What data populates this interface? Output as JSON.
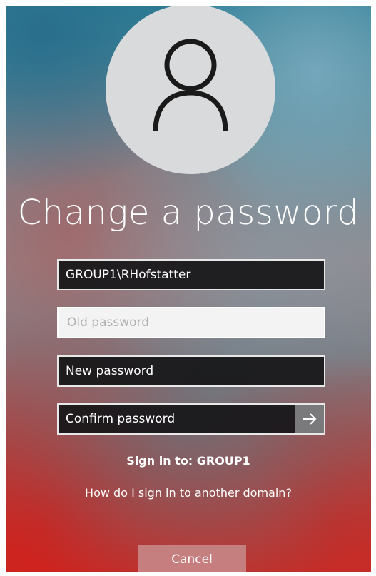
{
  "header": {
    "avatar_icon": "user-icon"
  },
  "title": "Change a password",
  "form": {
    "username_value": "GROUP1\\RHofstatter",
    "old_password_placeholder": "Old password",
    "new_password_placeholder": "New password",
    "confirm_password_placeholder": "Confirm password",
    "submit_icon": "arrow-right-icon"
  },
  "sign_in_to": "Sign in to: GROUP1",
  "other_domain_link": "How do I sign in to another domain?",
  "cancel_label": "Cancel"
}
